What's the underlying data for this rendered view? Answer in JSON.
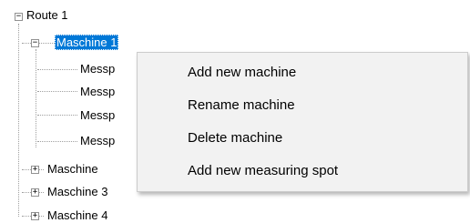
{
  "tree": {
    "root": {
      "label": "Route 1",
      "expander": "⊟"
    },
    "machines": [
      {
        "label": "Maschine 1",
        "expander": "−",
        "selected": true,
        "children": [
          "Messp",
          "Messp",
          "Messp",
          "Messp"
        ]
      },
      {
        "label": "Maschine",
        "expander": "+"
      },
      {
        "label": "Maschine 3",
        "expander": "+"
      },
      {
        "label": "Maschine 4",
        "expander": "+"
      }
    ]
  },
  "context_menu": {
    "items": [
      "Add new machine",
      "Rename machine",
      "Delete machine",
      "Add new measuring spot"
    ]
  }
}
